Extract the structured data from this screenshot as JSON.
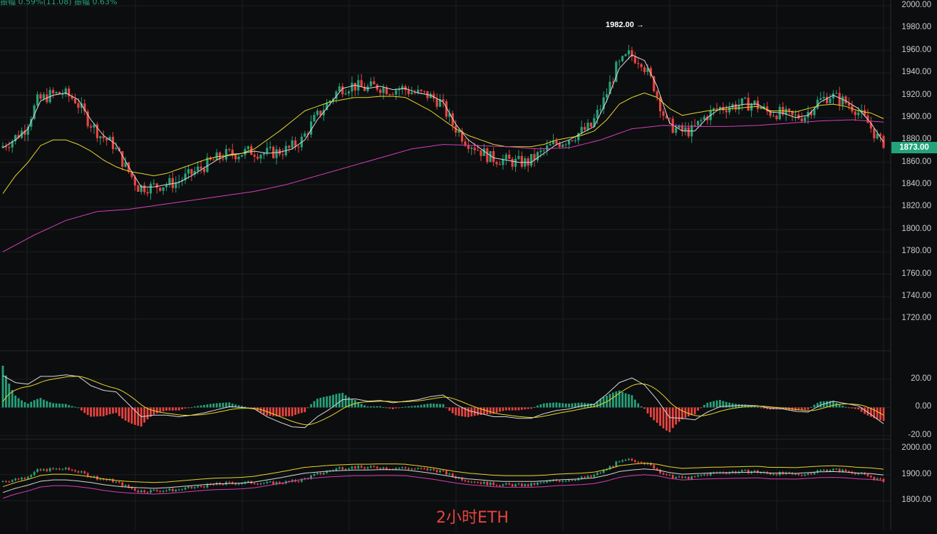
{
  "header": {
    "info_text": "振幅 0.59%(11.08)  振幅 0.63%"
  },
  "watermark": "2小时ETH",
  "current_price": "1873.00",
  "peak_label": "1982.00 →",
  "colors": {
    "background": "#0c0d0f",
    "grid": "#1c1e22",
    "up": "#26a17a",
    "down": "#e8443f",
    "ma_short": "#d9d9d9",
    "ma_mid": "#e7d62a",
    "ma_long": "#d63fb5"
  },
  "chart_data": [
    {
      "type": "candlestick",
      "panel": "main",
      "title": "",
      "xlabel": "",
      "ylabel": "",
      "ylim": [
        1710,
        2000
      ],
      "y_ticks": [
        "2000.00",
        "1980.00",
        "1960.00",
        "1940.00",
        "1920.00",
        "1900.00",
        "1880.00",
        "1860.00",
        "1840.00",
        "1820.00",
        "1800.00",
        "1780.00",
        "1760.00",
        "1740.00",
        "1720.00"
      ],
      "grid": true,
      "series": [
        {
          "name": "",
          "role": "ma_short",
          "points": [
            [
              0,
              1873
            ],
            [
              4,
              1880
            ],
            [
              8,
              1890
            ],
            [
              12,
              1915
            ],
            [
              16,
              1920
            ],
            [
              20,
              1922
            ],
            [
              24,
              1916
            ],
            [
              28,
              1898
            ],
            [
              32,
              1884
            ],
            [
              36,
              1876
            ],
            [
              40,
              1856
            ],
            [
              44,
              1838
            ],
            [
              48,
              1838
            ],
            [
              52,
              1840
            ],
            [
              56,
              1842
            ],
            [
              60,
              1848
            ],
            [
              64,
              1855
            ],
            [
              68,
              1862
            ],
            [
              72,
              1867
            ],
            [
              76,
              1868
            ],
            [
              80,
              1870
            ],
            [
              84,
              1868
            ],
            [
              88,
              1869
            ],
            [
              92,
              1872
            ],
            [
              96,
              1880
            ],
            [
              100,
              1898
            ],
            [
              104,
              1912
            ],
            [
              108,
              1926
            ],
            [
              112,
              1929
            ],
            [
              116,
              1926
            ],
            [
              120,
              1928
            ],
            [
              124,
              1925
            ],
            [
              128,
              1926
            ],
            [
              132,
              1922
            ],
            [
              136,
              1920
            ],
            [
              140,
              1914
            ],
            [
              144,
              1894
            ],
            [
              148,
              1880
            ],
            [
              152,
              1872
            ],
            [
              156,
              1864
            ],
            [
              160,
              1862
            ],
            [
              164,
              1860
            ],
            [
              168,
              1860
            ],
            [
              172,
              1868
            ],
            [
              176,
              1876
            ],
            [
              180,
              1880
            ],
            [
              184,
              1886
            ],
            [
              188,
              1892
            ],
            [
              192,
              1915
            ],
            [
              196,
              1944
            ],
            [
              200,
              1956
            ],
            [
              204,
              1951
            ],
            [
              208,
              1928
            ],
            [
              212,
              1895
            ],
            [
              216,
              1888
            ],
            [
              220,
              1888
            ],
            [
              224,
              1900
            ],
            [
              228,
              1908
            ],
            [
              232,
              1910
            ],
            [
              236,
              1912
            ],
            [
              240,
              1912
            ],
            [
              244,
              1905
            ],
            [
              248,
              1904
            ],
            [
              252,
              1900
            ],
            [
              256,
              1902
            ],
            [
              260,
              1914
            ],
            [
              264,
              1920
            ],
            [
              268,
              1915
            ],
            [
              272,
              1908
            ],
            [
              276,
              1895
            ],
            [
              280,
              1878
            ]
          ]
        },
        {
          "name": "",
          "role": "ma_mid",
          "points": [
            [
              0,
              1832
            ],
            [
              4,
              1848
            ],
            [
              8,
              1860
            ],
            [
              12,
              1875
            ],
            [
              16,
              1880
            ],
            [
              20,
              1880
            ],
            [
              24,
              1876
            ],
            [
              28,
              1870
            ],
            [
              32,
              1862
            ],
            [
              36,
              1856
            ],
            [
              40,
              1852
            ],
            [
              44,
              1850
            ],
            [
              48,
              1848
            ],
            [
              52,
              1850
            ],
            [
              56,
              1854
            ],
            [
              60,
              1858
            ],
            [
              64,
              1862
            ],
            [
              68,
              1865
            ],
            [
              72,
              1866
            ],
            [
              76,
              1868
            ],
            [
              80,
              1872
            ],
            [
              84,
              1880
            ],
            [
              88,
              1888
            ],
            [
              92,
              1897
            ],
            [
              96,
              1906
            ],
            [
              100,
              1910
            ],
            [
              104,
              1914
            ],
            [
              108,
              1916
            ],
            [
              112,
              1918
            ],
            [
              116,
              1918
            ],
            [
              120,
              1919
            ],
            [
              124,
              1919
            ],
            [
              128,
              1918
            ],
            [
              132,
              1912
            ],
            [
              136,
              1906
            ],
            [
              140,
              1898
            ],
            [
              144,
              1890
            ],
            [
              148,
              1884
            ],
            [
              152,
              1880
            ],
            [
              156,
              1876
            ],
            [
              160,
              1874
            ],
            [
              164,
              1874
            ],
            [
              168,
              1874
            ],
            [
              172,
              1876
            ],
            [
              176,
              1880
            ],
            [
              184,
              1884
            ],
            [
              188,
              1888
            ],
            [
              192,
              1898
            ],
            [
              196,
              1912
            ],
            [
              200,
              1918
            ],
            [
              204,
              1922
            ],
            [
              208,
              1918
            ],
            [
              212,
              1908
            ],
            [
              216,
              1902
            ],
            [
              220,
              1904
            ],
            [
              224,
              1906
            ],
            [
              228,
              1907
            ],
            [
              232,
              1908
            ],
            [
              236,
              1909
            ],
            [
              240,
              1910
            ],
            [
              244,
              1906
            ],
            [
              248,
              1906
            ],
            [
              252,
              1905
            ],
            [
              256,
              1908
            ],
            [
              260,
              1911
            ],
            [
              264,
              1912
            ],
            [
              268,
              1910
            ],
            [
              272,
              1906
            ],
            [
              276,
              1904
            ],
            [
              280,
              1899
            ]
          ]
        },
        {
          "name": "",
          "role": "ma_long",
          "points": [
            [
              0,
              1780
            ],
            [
              10,
              1795
            ],
            [
              20,
              1808
            ],
            [
              30,
              1816
            ],
            [
              40,
              1818
            ],
            [
              50,
              1822
            ],
            [
              60,
              1826
            ],
            [
              70,
              1830
            ],
            [
              80,
              1834
            ],
            [
              90,
              1840
            ],
            [
              100,
              1848
            ],
            [
              110,
              1856
            ],
            [
              120,
              1864
            ],
            [
              130,
              1872
            ],
            [
              140,
              1876
            ],
            [
              150,
              1875
            ],
            [
              160,
              1874
            ],
            [
              170,
              1872
            ],
            [
              180,
              1873
            ],
            [
              190,
              1880
            ],
            [
              200,
              1890
            ],
            [
              210,
              1893
            ],
            [
              220,
              1892
            ],
            [
              230,
              1892
            ],
            [
              240,
              1893
            ],
            [
              250,
              1895
            ],
            [
              260,
              1897
            ],
            [
              270,
              1898
            ],
            [
              280,
              1896
            ]
          ]
        }
      ],
      "annotations": [
        {
          "text": "1982.00 →",
          "x": 206,
          "y": 1982
        }
      ]
    },
    {
      "type": "macd",
      "panel": "macd",
      "title": "",
      "ylim": [
        -22,
        26
      ],
      "y_ticks": [
        "20.00",
        "0.00",
        "-20.00"
      ],
      "grid": true
    },
    {
      "type": "candlestick",
      "panel": "bottom",
      "title": "",
      "ylim": [
        1785,
        2003
      ],
      "y_ticks": [
        "2000.00",
        "1900.00",
        "1800.00"
      ],
      "grid": true
    }
  ]
}
